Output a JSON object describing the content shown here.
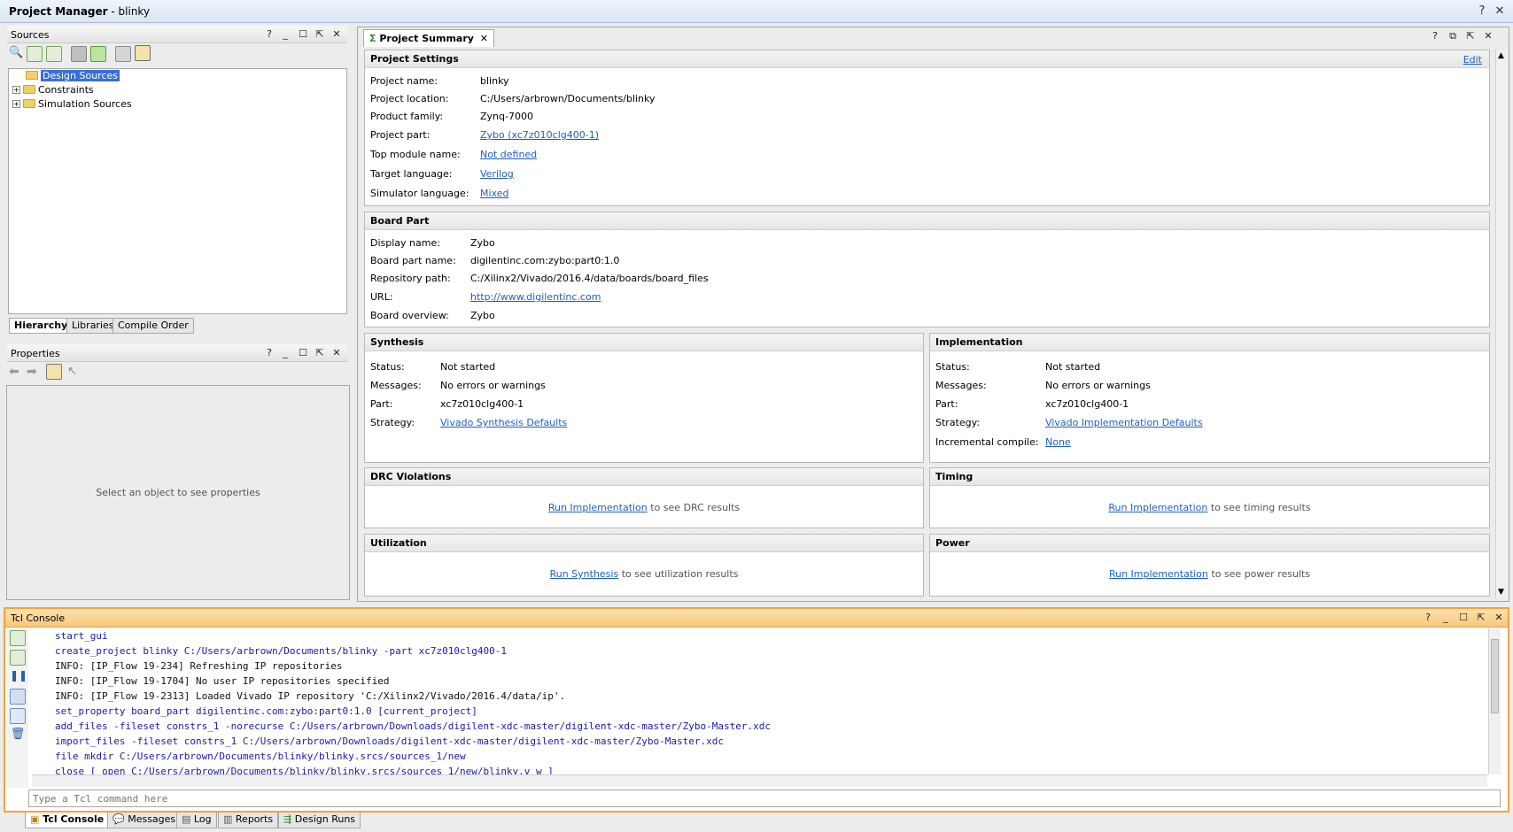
{
  "window": {
    "title": "Project Manager",
    "project": "blinky",
    "help": "?",
    "close": "✕"
  },
  "sources": {
    "title": "Sources",
    "tree": [
      "Design Sources",
      "Constraints",
      "Simulation Sources"
    ],
    "tabs": [
      "Hierarchy",
      "Libraries",
      "Compile Order"
    ]
  },
  "properties": {
    "title": "Properties",
    "empty": "Select an object to see properties"
  },
  "summary": {
    "tab": "Project Summary",
    "project_settings": {
      "title": "Project Settings",
      "edit": "Edit",
      "rows": [
        {
          "k": "Project name:",
          "v": "blinky"
        },
        {
          "k": "Project location:",
          "v": "C:/Users/arbrown/Documents/blinky"
        },
        {
          "k": "Product family:",
          "v": "Zynq-7000"
        },
        {
          "k": "Project part:",
          "v": "Zybo (xc7z010clg400-1)"
        },
        {
          "k": "Top module name:",
          "v": "Not defined"
        },
        {
          "k": "Target language:",
          "v": "Verilog"
        },
        {
          "k": "Simulator language:",
          "v": "Mixed"
        }
      ]
    },
    "board_part": {
      "title": "Board Part",
      "rows": [
        {
          "k": "Display name:",
          "v": "Zybo"
        },
        {
          "k": "Board part name:",
          "v": "digilentinc.com:zybo:part0:1.0"
        },
        {
          "k": "Repository path:",
          "v": "C:/Xilinx2/Vivado/2016.4/data/boards/board_files"
        },
        {
          "k": "URL:",
          "v": "http://www.digilentinc.com"
        },
        {
          "k": "Board overview:",
          "v": "Zybo"
        }
      ]
    },
    "synthesis": {
      "title": "Synthesis",
      "rows": [
        {
          "k": "Status:",
          "v": "Not started"
        },
        {
          "k": "Messages:",
          "v": "No errors or warnings"
        },
        {
          "k": "Part:",
          "v": "xc7z010clg400-1"
        },
        {
          "k": "Strategy:",
          "v": "Vivado Synthesis Defaults"
        }
      ]
    },
    "implementation": {
      "title": "Implementation",
      "rows": [
        {
          "k": "Status:",
          "v": "Not started"
        },
        {
          "k": "Messages:",
          "v": "No errors or warnings"
        },
        {
          "k": "Part:",
          "v": "xc7z010clg400-1"
        },
        {
          "k": "Strategy:",
          "v": "Vivado Implementation Defaults"
        },
        {
          "k": "Incremental compile:",
          "v": "None"
        }
      ]
    },
    "drc": {
      "title": "DRC Violations",
      "link": "Run Implementation",
      "rest": "to see DRC results"
    },
    "timing": {
      "title": "Timing",
      "link": "Run Implementation",
      "rest": "to see timing results"
    },
    "utilization": {
      "title": "Utilization",
      "link": "Run Synthesis",
      "rest": "to see utilization results"
    },
    "power": {
      "title": "Power",
      "link": "Run Implementation",
      "rest": "to see power results"
    }
  },
  "console": {
    "title": "Tcl Console",
    "lines": [
      "start_gui",
      "create_project blinky C:/Users/arbrown/Documents/blinky -part xc7z010clg400-1",
      "INFO: [IP_Flow 19-234] Refreshing IP repositories",
      "INFO: [IP_Flow 19-1704] No user IP repositories specified",
      "INFO: [IP_Flow 19-2313] Loaded Vivado IP repository 'C:/Xilinx2/Vivado/2016.4/data/ip'.",
      "set_property board_part digilentinc.com:zybo:part0:1.0 [current_project]",
      "add_files -fileset constrs_1 -norecurse C:/Users/arbrown/Downloads/digilent-xdc-master/digilent-xdc-master/Zybo-Master.xdc",
      "import_files -fileset constrs_1 C:/Users/arbrown/Downloads/digilent-xdc-master/digilent-xdc-master/Zybo-Master.xdc",
      "file mkdir C:/Users/arbrown/Documents/blinky/blinky.srcs/sources_1/new",
      "close [ open C:/Users/arbrown/Documents/blinky/blinky.srcs/sources_1/new/blinky.v w ]"
    ],
    "input_placeholder": "Type a Tcl command here",
    "tabs": [
      "Tcl Console",
      "Messages",
      "Log",
      "Reports",
      "Design Runs"
    ]
  }
}
